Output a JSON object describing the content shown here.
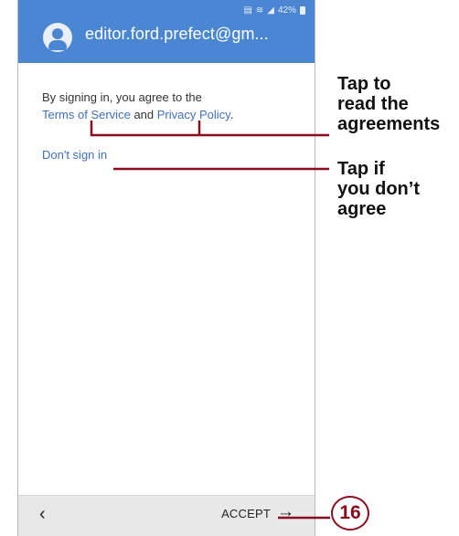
{
  "status_bar": {
    "icons": [
      "nfc-icon",
      "wifi-icon",
      "signal-icon"
    ],
    "battery": "42%"
  },
  "header": {
    "account_email": "editor.ford.prefect@gm..."
  },
  "content": {
    "agree_text": "By signing in, you agree to the",
    "terms_link": "Terms of Service",
    "and_text": "and",
    "privacy_link": "Privacy Policy",
    "period": ".",
    "dont_sign_in": "Don't sign in"
  },
  "bottom_bar": {
    "back_icon": "chevron-left-icon",
    "accept_label": "ACCEPT",
    "accept_icon": "arrow-right-icon"
  },
  "annotations": {
    "callout_1": [
      "Tap to",
      "read the",
      "agreements"
    ],
    "callout_2": [
      "Tap if",
      "you don’t",
      "agree"
    ],
    "step_number": "16"
  },
  "colors": {
    "header": "#4a86d2",
    "link": "#3f6fbe",
    "leader": "#8b0d1c"
  }
}
